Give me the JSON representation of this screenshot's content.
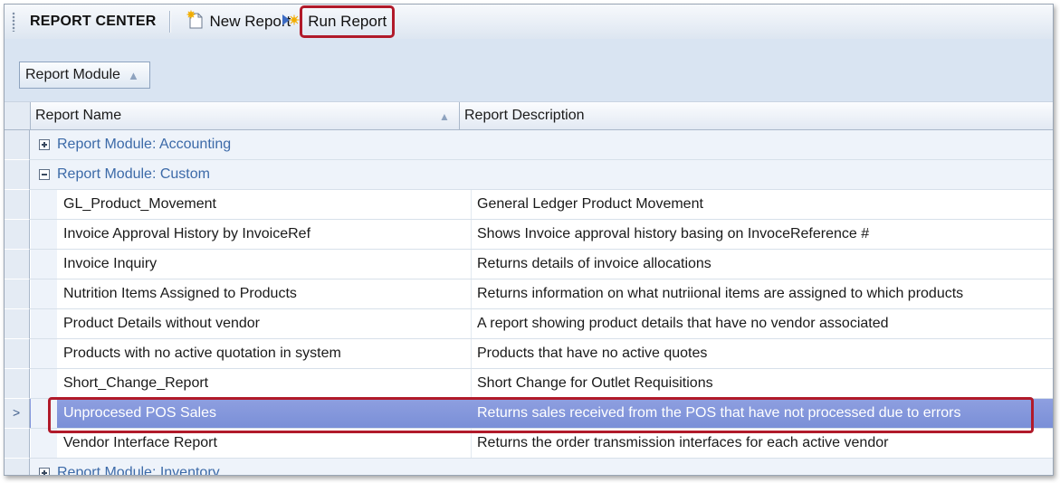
{
  "toolbar": {
    "title": "REPORT CENTER",
    "new_report_label": "New Report",
    "run_report_label": "Run Report",
    "new_report_icon": "new-document-icon",
    "run_report_icon": "run-arrow-icon"
  },
  "group_panel": {
    "chip_label": "Report Module",
    "sort_icon": "sort-ascending-icon"
  },
  "grid": {
    "columns": [
      "Report Name",
      "Report Description"
    ],
    "groups": [
      {
        "label": "Report Module: Accounting",
        "expanded": false
      },
      {
        "label": "Report Module: Custom",
        "expanded": true
      },
      {
        "label": "Report Module: Inventory",
        "expanded": false
      }
    ],
    "rows": [
      {
        "name": "GL_Product_Movement",
        "description": "General Ledger Product Movement"
      },
      {
        "name": "Invoice Approval History by InvoiceRef",
        "description": "Shows Invoice approval history basing on InvoceReference #"
      },
      {
        "name": "Invoice Inquiry",
        "description": "Returns details of invoice allocations"
      },
      {
        "name": "Nutrition Items Assigned to Products",
        "description": "Returns information on what nutriional items are assigned to which products"
      },
      {
        "name": "Product Details without vendor",
        "description": "A report showing product details that have no vendor associated"
      },
      {
        "name": "Products with no active quotation in system",
        "description": "Products that have no active quotes"
      },
      {
        "name": "Short_Change_Report",
        "description": "Short Change for Outlet Requisitions"
      },
      {
        "name": "Unprocesed POS Sales",
        "description": "Returns sales received from the POS that have not processed due to errors",
        "selected": true
      },
      {
        "name": "Vendor Interface Report",
        "description": "Returns the order transmission interfaces for each active vendor"
      }
    ]
  },
  "colors": {
    "selection": "#7f93da",
    "highlight_border": "#b11a2a",
    "group_text": "#3c6aa8",
    "panel": "#d9e4f2"
  }
}
